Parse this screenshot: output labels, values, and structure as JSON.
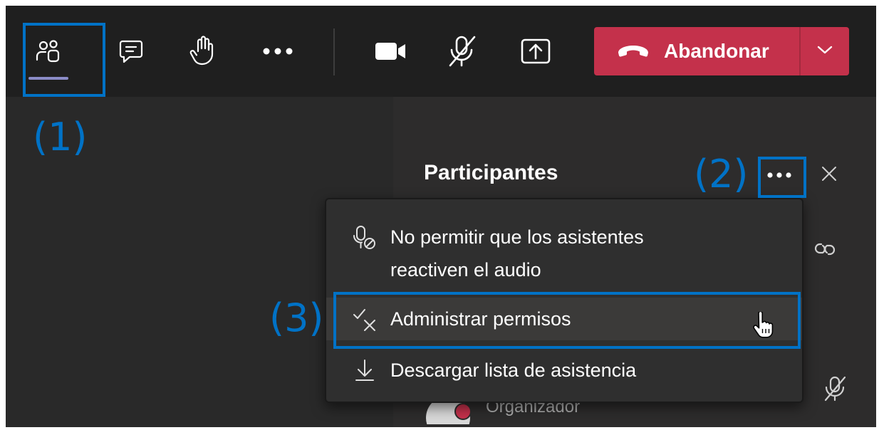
{
  "toolbar": {
    "leave_label": "Abandonar",
    "buttons": [
      {
        "name": "participants-icon",
        "active": true
      },
      {
        "name": "chat-icon"
      },
      {
        "name": "raise-hand-icon"
      },
      {
        "name": "more-icon"
      },
      {
        "name": "camera-icon"
      },
      {
        "name": "mic-off-icon"
      },
      {
        "name": "share-screen-icon"
      },
      {
        "name": "phone-hangup-icon"
      },
      {
        "name": "chevron-down-icon"
      }
    ]
  },
  "panel": {
    "title": "Participantes",
    "role_label": "Organizador"
  },
  "menu": {
    "items": [
      {
        "icon": "mic-blocked-icon",
        "label": "No permitir que los asistentes reactiven el audio"
      },
      {
        "icon": "check-cross-icon",
        "label": "Administrar permisos",
        "hovered": true
      },
      {
        "icon": "download-icon",
        "label": "Descargar lista de asistencia"
      }
    ]
  },
  "annotations": {
    "label_1": "(1)",
    "label_2": "(2)",
    "label_3": "(3)"
  },
  "colors": {
    "accent": "#0072c6",
    "leave": "#c4314b",
    "active_indicator": "#8b8cc7"
  }
}
